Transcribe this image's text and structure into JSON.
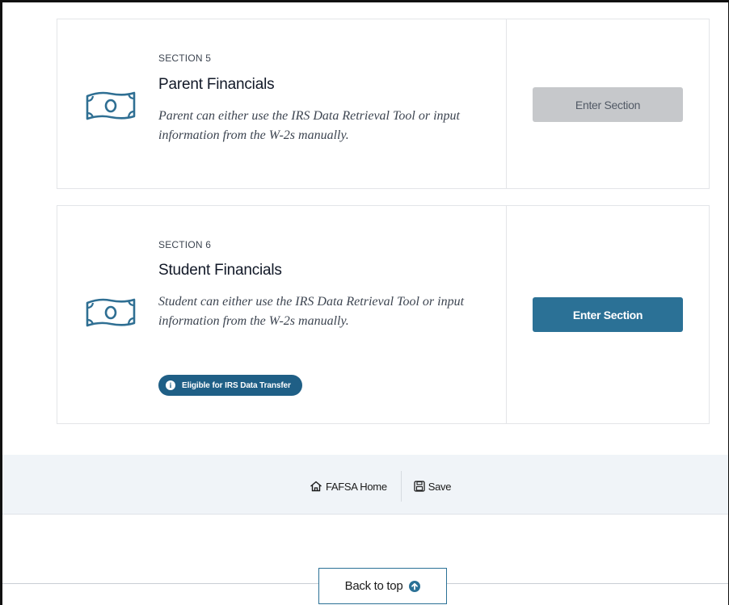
{
  "sections": [
    {
      "label": "SECTION 5",
      "title": "Parent Financials",
      "description": "Parent can either use the IRS Data Retrieval Tool or input information from the W-2s manually.",
      "button_label": "Enter Section",
      "button_state": "disabled"
    },
    {
      "label": "SECTION 6",
      "title": "Student Financials",
      "description": "Student can either use the IRS Data Retrieval Tool or input information from the W-2s manually.",
      "button_label": "Enter Section",
      "button_state": "enabled",
      "badge_label": "Eligible for IRS Data Transfer"
    }
  ],
  "footer": {
    "home_label": "FAFSA Home",
    "save_label": "Save"
  },
  "back_to_top_label": "Back to top",
  "colors": {
    "primary": "#2b7196",
    "badge": "#1f5f86",
    "disabled_button": "#c6c8cb",
    "icon_stroke": "#2f6f93",
    "footer_band": "#f0f4f8"
  },
  "icons": {
    "section_icon": "money-bill-icon",
    "home_icon": "home-icon",
    "save_icon": "save-icon",
    "badge_icon": "info-icon",
    "back_to_top_icon": "arrow-up-circle-icon"
  }
}
